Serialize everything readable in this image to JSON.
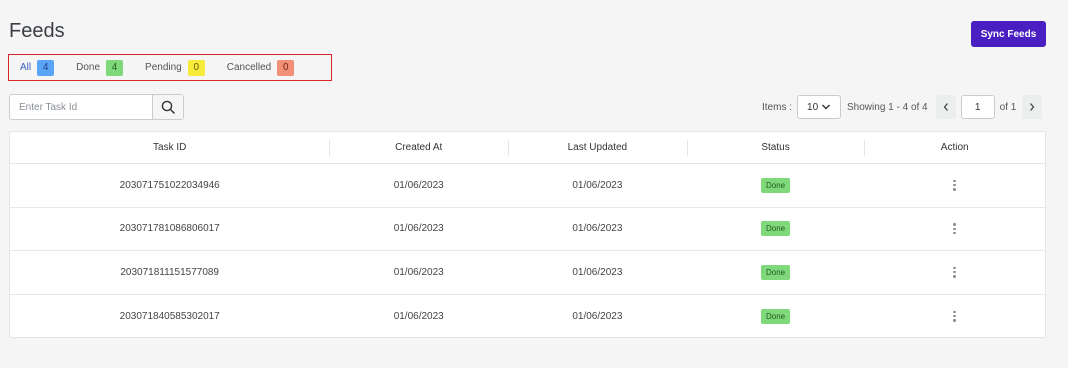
{
  "header": {
    "title": "Feeds",
    "sync_button_label": "Sync Feeds"
  },
  "filters": [
    {
      "label": "All",
      "count": "4",
      "kind": "all",
      "active": true
    },
    {
      "label": "Done",
      "count": "4",
      "kind": "done",
      "active": false
    },
    {
      "label": "Pending",
      "count": "0",
      "kind": "pending",
      "active": false
    },
    {
      "label": "Cancelled",
      "count": "0",
      "kind": "cancelled",
      "active": false
    }
  ],
  "search": {
    "placeholder": "Enter Task Id",
    "value": ""
  },
  "pagination": {
    "items_label": "Items :",
    "items_per_page": "10",
    "showing_text": "Showing 1 - 4 of 4",
    "current_page": "1",
    "of_text": "of",
    "total_pages": "1"
  },
  "table": {
    "columns": [
      "Task ID",
      "Created At",
      "Last Updated",
      "Status",
      "Action"
    ],
    "rows": [
      {
        "task_id": "203071751022034946",
        "created_at": "01/06/2023",
        "last_updated": "01/06/2023",
        "status": "Done"
      },
      {
        "task_id": "203071781086806017",
        "created_at": "01/06/2023",
        "last_updated": "01/06/2023",
        "status": "Done"
      },
      {
        "task_id": "203071811151577089",
        "created_at": "01/06/2023",
        "last_updated": "01/06/2023",
        "status": "Done"
      },
      {
        "task_id": "203071840585302017",
        "created_at": "01/06/2023",
        "last_updated": "01/06/2023",
        "status": "Done"
      }
    ]
  },
  "colors": {
    "primary_button": "#4a1fc1",
    "done": "#7fd87a",
    "pending": "#f6ea3a",
    "cancelled": "#f28f77",
    "all": "#5aa5f5",
    "filter_outline": "#d9262c"
  },
  "icons": {
    "search": "search-icon",
    "chevron_down": "chevron-down-icon",
    "prev": "chevron-left-icon",
    "next": "chevron-right-icon",
    "row_action": "kebab-menu-icon"
  }
}
